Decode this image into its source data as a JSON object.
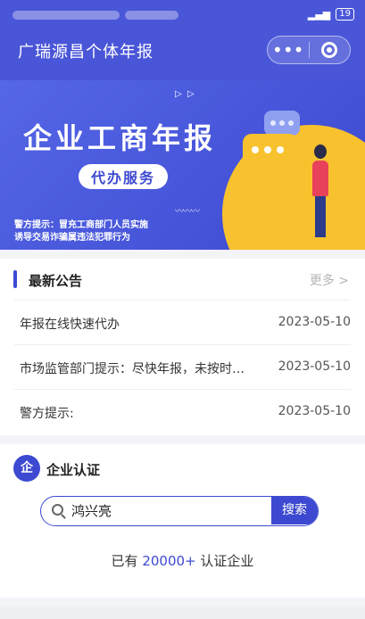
{
  "status_bar": {
    "battery": "19"
  },
  "nav": {
    "title": "广瑞源昌个体年报",
    "more_glyph": "•••"
  },
  "banner": {
    "headline": "企业工商年报",
    "pill": "代办服务",
    "warning_line1": "警方提示：冒充工商部门人员实施",
    "warning_line2": "诱导交易诈骗属违法犯罪行为"
  },
  "notices": {
    "title": "最新公告",
    "more": "更多 >",
    "items": [
      {
        "text": "年报在线快速代办",
        "date": "2023-05-10"
      },
      {
        "text": "市场监管部门提示：尽快年报，未按时…",
        "date": "2023-05-10"
      },
      {
        "text": "警方提示:",
        "date": "2023-05-10"
      }
    ]
  },
  "cert": {
    "logo_char": "企",
    "title": "企业认证",
    "search_value": "鸿兴亮",
    "search_button": "搜索",
    "count_prefix": "已有",
    "count_number": "20000+",
    "count_suffix": "认证企业"
  },
  "colors": {
    "primary": "#3c49d0",
    "accent_yellow": "#f7c22d"
  }
}
